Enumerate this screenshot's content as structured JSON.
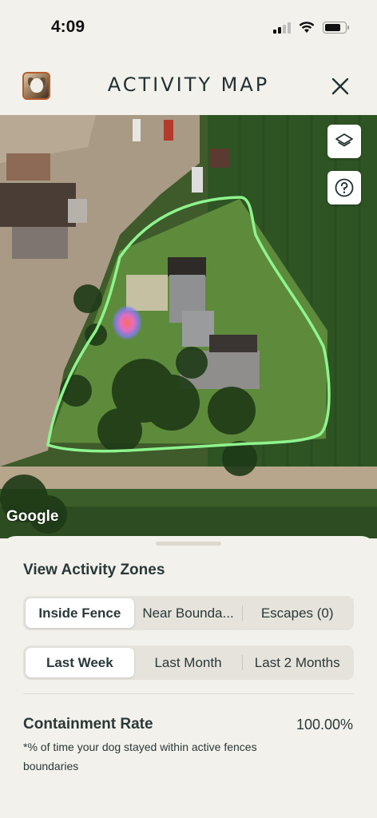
{
  "status_bar": {
    "time": "4:09"
  },
  "header": {
    "title": "ACTIVITY MAP"
  },
  "map": {
    "attribution": "Google",
    "fence_color": "#8ef58e"
  },
  "sheet": {
    "section_title": "View Activity Zones",
    "zone_tabs": [
      {
        "label": "Inside Fence",
        "selected": true
      },
      {
        "label": "Near Bounda...",
        "selected": false
      },
      {
        "label": "Escapes (0)",
        "selected": false
      }
    ],
    "period_tabs": [
      {
        "label": "Last Week",
        "selected": true
      },
      {
        "label": "Last Month",
        "selected": false
      },
      {
        "label": "Last 2 Months",
        "selected": false
      }
    ],
    "containment": {
      "label": "Containment Rate",
      "value": "100.00%",
      "note": "*% of time your dog stayed within active fences boundaries"
    }
  },
  "icons": {
    "close": "close-icon",
    "layers": "layers-icon",
    "help": "help-icon"
  }
}
